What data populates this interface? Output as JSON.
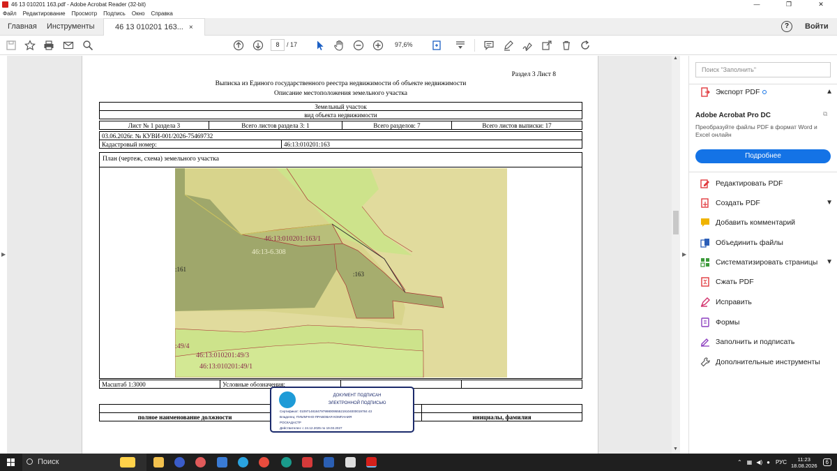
{
  "window": {
    "title": "46 13 010201 163.pdf - Adobe Acrobat Reader (32-bit)",
    "minimize": "—",
    "restore": "❐",
    "close": "✕"
  },
  "menu": [
    "Файл",
    "Редактирование",
    "Просмотр",
    "Подпись",
    "Окно",
    "Справка"
  ],
  "tabs": {
    "home": "Главная",
    "tools": "Инструменты",
    "document": "46 13 010201 163...",
    "close": "×",
    "help": "?",
    "signin": "Войти"
  },
  "toolbar": {
    "page_current": "8",
    "page_total": "/ 17",
    "zoom": "97,6%"
  },
  "document": {
    "section": "Раздел 3    Лист 8",
    "heading1": "Выписка из Единого государственного реестра недвижимости об объекте недвижимости",
    "heading2": "Описание местоположения земельного участка",
    "object_type": "Земельный участок",
    "object_label": "вид объекта недвижимости",
    "sheet_no": "Лист № 1 раздела 3",
    "sheets_section": "Всего листов раздела 3: 1",
    "sections_total": "Всего разделов: 7",
    "sheets_total": "Всего листов выписки: 17",
    "record": "03.06.2026г. № КУВИ-001/2026-75469732",
    "cad_label": "Кадастровый номер:",
    "cad_value": "46:13:010201:163",
    "plan_title": "План (чертеж, схема) земельного участка",
    "scale": "Масштаб 1:3000",
    "legend": "Условные обозначения:",
    "position_label": "полное наименование должности",
    "initials_label": "инициалы, фамилия",
    "map_labels": {
      "a": "46:13:010201:163/1",
      "b": "46:13-6.308",
      "c": ":161",
      "d": ":163",
      "e": ":49/4",
      "f": "46:13:010201:49/3",
      "g": "46:13:010201:49/1"
    }
  },
  "stamp": {
    "line1": "ДОКУМЕНТ ПОДПИСАН",
    "line2": "ЭЛЕКТРОННОЙ ПОДПИСЬЮ",
    "cert": "Сертификат: 01097148184797998009555219104000019784 43",
    "owner1": "Владелец: ПУБЛИЧНО-ПРАВОВАЯ КОМПАНИЯ",
    "owner2": "РОСКАДАСТР",
    "valid": "Действителен: с 24.12.2025 по 19.03.2027"
  },
  "right_panel": {
    "search_placeholder": "Поиск \"Заполнить\"",
    "export": "Экспорт PDF",
    "promo_title": "Adobe Acrobat Pro DC",
    "promo_text": "Преобразуйте файлы PDF в формат Word и Excel онлайн",
    "promo_button": "Подробнее",
    "tools": [
      {
        "label": "Редактировать PDF",
        "icon": "edit-pdf-icon",
        "color": "#e03a3e"
      },
      {
        "label": "Создать PDF",
        "icon": "create-pdf-icon",
        "color": "#e03a3e"
      },
      {
        "label": "Добавить комментарий",
        "icon": "comment-icon",
        "color": "#f0b400"
      },
      {
        "label": "Объединить файлы",
        "icon": "combine-files-icon",
        "color": "#2c5fb8"
      },
      {
        "label": "Систематизировать страницы",
        "icon": "organize-pages-icon",
        "color": "#3c9a3a"
      },
      {
        "label": "Сжать PDF",
        "icon": "compress-pdf-icon",
        "color": "#e03a3e"
      },
      {
        "label": "Исправить",
        "icon": "redact-icon",
        "color": "#d2306b"
      },
      {
        "label": "Формы",
        "icon": "forms-icon",
        "color": "#8c3fbf"
      },
      {
        "label": "Заполнить и подписать",
        "icon": "fill-sign-icon",
        "color": "#8c3fbf"
      },
      {
        "label": "Дополнительные инструменты",
        "icon": "more-tools-icon",
        "color": "#555555"
      }
    ]
  },
  "taskbar": {
    "search": "Поиск",
    "lang": "РУС",
    "time": "11:23",
    "date": "18.08.2026",
    "notifications": "6"
  }
}
